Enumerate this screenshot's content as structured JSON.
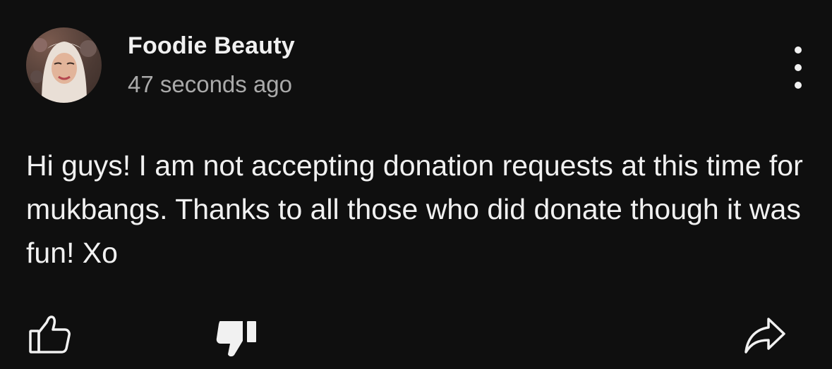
{
  "comment": {
    "author": "Foodie Beauty",
    "timestamp": "47 seconds ago",
    "text": "Hi guys! I am not accepting donation requests at this time for mukbangs. Thanks to all those who did donate though it was fun! Xo"
  },
  "icons": {
    "menu": "more-vert-icon",
    "like": "thumbs-up-icon",
    "dislike": "thumbs-down-filled-icon",
    "share": "share-icon"
  },
  "colors": {
    "background": "#0f0f0f",
    "text": "#f1f1f1",
    "secondary_text": "#aaaaaa"
  }
}
